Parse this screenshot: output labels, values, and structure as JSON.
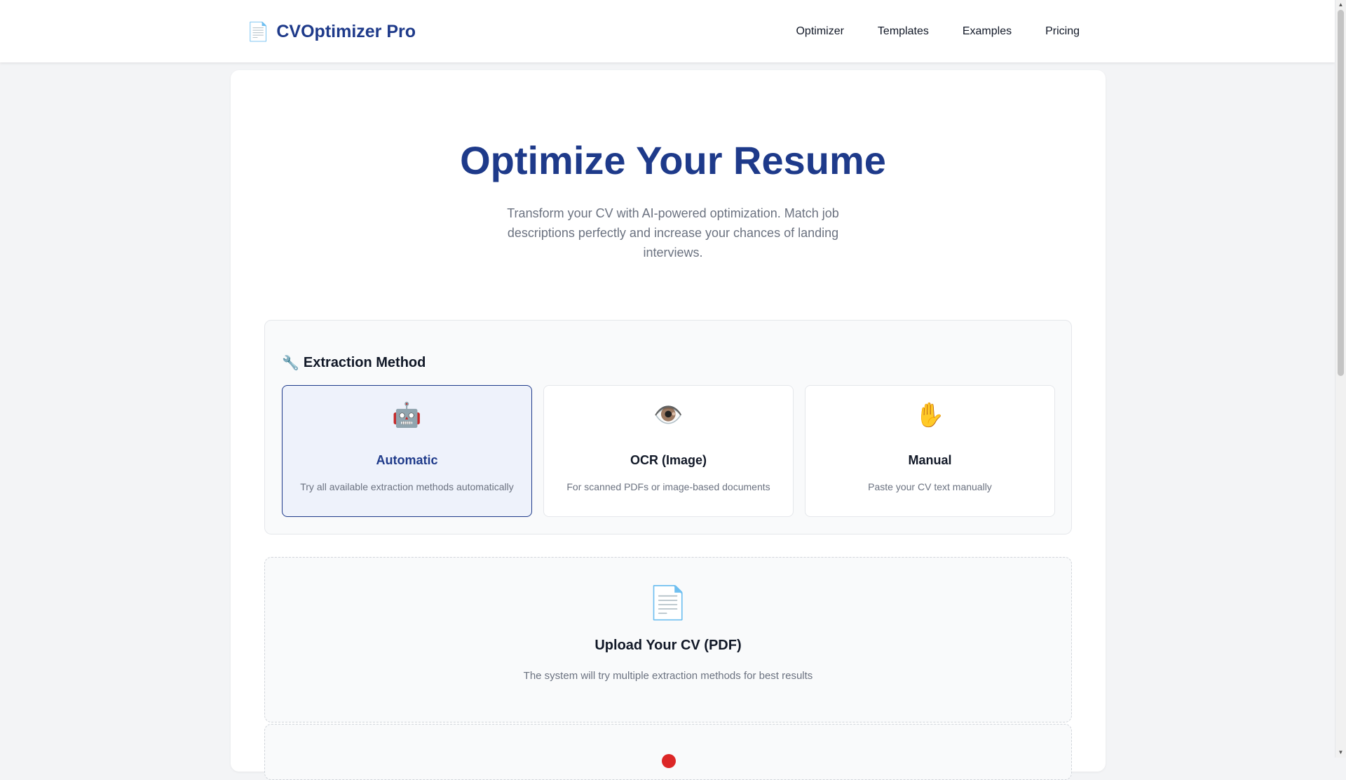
{
  "nav": {
    "brand_icon": "document-icon",
    "brand_glyph": "📄",
    "brand_name": "CVOptimizer Pro",
    "links": [
      {
        "label": "Optimizer"
      },
      {
        "label": "Templates"
      },
      {
        "label": "Examples"
      },
      {
        "label": "Pricing"
      }
    ]
  },
  "hero": {
    "title": "Optimize Your Resume",
    "subtitle": "Transform your CV with AI-powered optimization. Match job descriptions perfectly and increase your chances of landing interviews."
  },
  "extraction": {
    "heading_icon": "wrench-icon",
    "heading_glyph": "🔧",
    "heading": "Extraction Method",
    "selected": "Automatic",
    "options": [
      {
        "icon": "robot-icon",
        "glyph": "🤖",
        "title": "Automatic",
        "desc": "Try all available extraction methods automatically"
      },
      {
        "icon": "eye-icon",
        "glyph": "👁️",
        "title": "OCR (Image)",
        "desc": "For scanned PDFs or image-based documents"
      },
      {
        "icon": "hand-icon",
        "glyph": "✋",
        "title": "Manual",
        "desc": "Paste your CV text manually"
      }
    ]
  },
  "upload": {
    "icon": "document-icon",
    "glyph": "📄",
    "title": "Upload Your CV (PDF)",
    "desc": "The system will try multiple extraction methods for best results"
  },
  "colors": {
    "brand": "#1e3a8a",
    "selected_bg": "#eef2fb",
    "muted_text": "#6b7280"
  }
}
